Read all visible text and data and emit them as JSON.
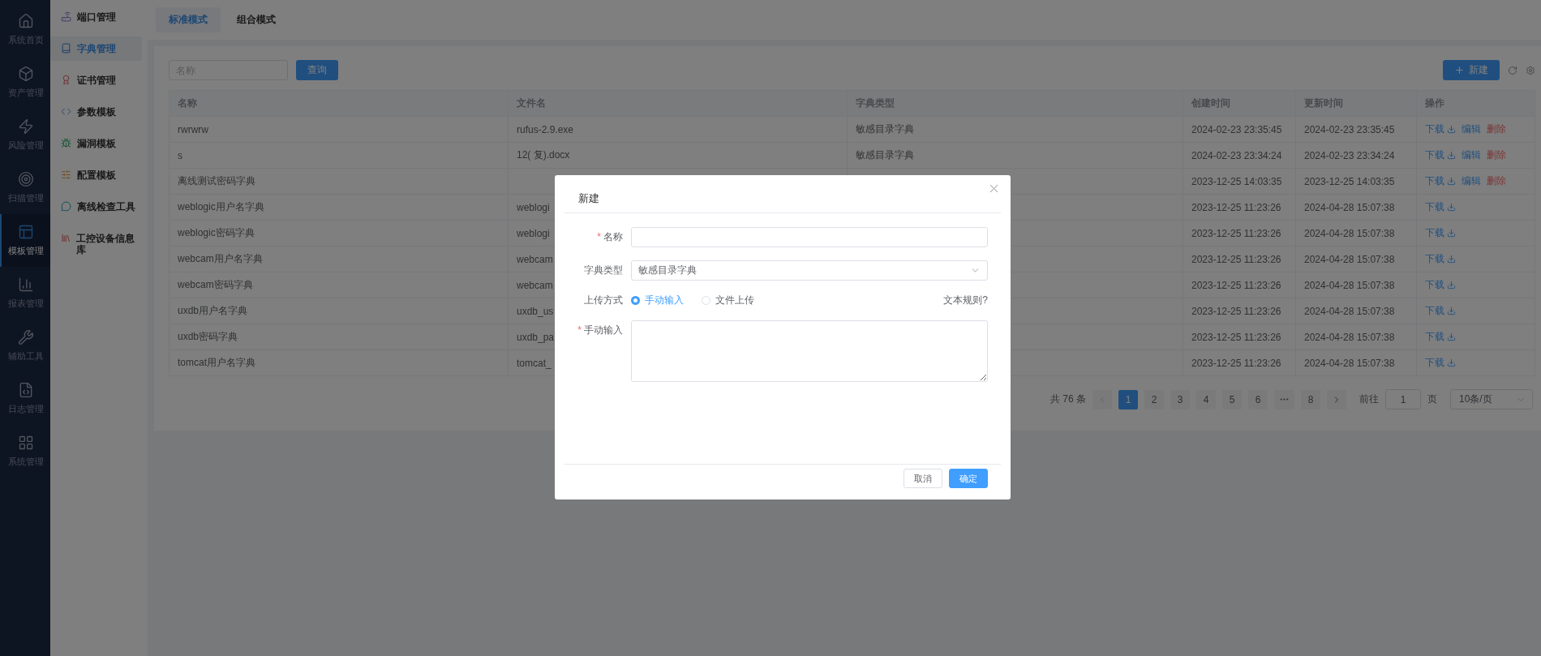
{
  "nav_rail": {
    "items": [
      {
        "label": "系统首页",
        "selected": false
      },
      {
        "label": "资产管理",
        "selected": false
      },
      {
        "label": "风险管理",
        "selected": false
      },
      {
        "label": "扫描管理",
        "selected": false
      },
      {
        "label": "模板管理",
        "selected": true
      },
      {
        "label": "报表管理",
        "selected": false
      },
      {
        "label": "辅助工具",
        "selected": false
      },
      {
        "label": "日志管理",
        "selected": false
      },
      {
        "label": "系统管理",
        "selected": false
      }
    ]
  },
  "sidebar": {
    "items": [
      {
        "label": "端口管理",
        "selected": false
      },
      {
        "label": "字典管理",
        "selected": true
      },
      {
        "label": "证书管理",
        "selected": false
      },
      {
        "label": "参数模板",
        "selected": false
      },
      {
        "label": "漏洞模板",
        "selected": false
      },
      {
        "label": "配置模板",
        "selected": false
      },
      {
        "label": "离线检查工具",
        "selected": false
      },
      {
        "label": "工控设备信息库",
        "selected": false
      }
    ]
  },
  "mode_tabs": [
    {
      "label": "标准模式",
      "selected": true
    },
    {
      "label": "组合模式",
      "selected": false
    }
  ],
  "toolbar": {
    "search": {
      "placeholder": "名称"
    },
    "query_button": "查询",
    "new_button": "新建"
  },
  "table": {
    "columns": [
      "名称",
      "文件名",
      "字典类型",
      "创建时间",
      "更新时间",
      "操作"
    ],
    "rows": [
      {
        "name": "rwrwrw",
        "file_name": "rufus-2.9.exe",
        "dict_type": "敏感目录字典",
        "created": "2024-02-23 23:35:45",
        "updated": "2024-02-23 23:35:45",
        "actions": [
          {
            "kind": "download",
            "label": "下载"
          },
          {
            "kind": "edit",
            "label": "编辑"
          },
          {
            "kind": "delete",
            "label": "删除"
          }
        ]
      },
      {
        "name": "s",
        "file_name": "12( 复).docx",
        "dict_type": "敏感目录字典",
        "created": "2024-02-23 23:34:24",
        "updated": "2024-02-23 23:34:24",
        "actions": [
          {
            "kind": "download",
            "label": "下载"
          },
          {
            "kind": "edit",
            "label": "编辑"
          },
          {
            "kind": "delete",
            "label": "删除"
          }
        ]
      },
      {
        "name": "离线测试密码字典",
        "created": "2023-12-25 14:03:35",
        "updated": "2023-12-25 14:03:35",
        "actions": [
          {
            "kind": "download",
            "label": "下载"
          },
          {
            "kind": "edit",
            "label": "编辑"
          },
          {
            "kind": "delete",
            "label": "删除"
          }
        ]
      },
      {
        "name": "weblogic用户名字典",
        "file_name": "weblogi",
        "created": "2023-12-25 11:23:26",
        "updated": "2024-04-28 15:07:38",
        "actions": [
          {
            "kind": "download",
            "label": "下载"
          }
        ]
      },
      {
        "name": "weblogic密码字典",
        "file_name": "weblogi",
        "created": "2023-12-25 11:23:26",
        "updated": "2024-04-28 15:07:38",
        "actions": [
          {
            "kind": "download",
            "label": "下载"
          }
        ]
      },
      {
        "name": "webcam用户名字典",
        "file_name": "webcam",
        "created": "2023-12-25 11:23:26",
        "updated": "2024-04-28 15:07:38",
        "actions": [
          {
            "kind": "download",
            "label": "下载"
          }
        ]
      },
      {
        "name": "webcam密码字典",
        "file_name": "webcam",
        "created": "2023-12-25 11:23:26",
        "updated": "2024-04-28 15:07:38",
        "actions": [
          {
            "kind": "download",
            "label": "下载"
          }
        ]
      },
      {
        "name": "uxdb用户名字典",
        "file_name": "uxdb_us",
        "created": "2023-12-25 11:23:26",
        "updated": "2024-04-28 15:07:38",
        "actions": [
          {
            "kind": "download",
            "label": "下载"
          }
        ]
      },
      {
        "name": "uxdb密码字典",
        "file_name": "uxdb_pa",
        "created": "2023-12-25 11:23:26",
        "updated": "2024-04-28 15:07:38",
        "actions": [
          {
            "kind": "download",
            "label": "下载"
          }
        ]
      },
      {
        "name": "tomcat用户名字典",
        "file_name": "tomcat_",
        "created": "2023-12-25 11:23:26",
        "updated": "2024-04-28 15:07:38",
        "actions": [
          {
            "kind": "download",
            "label": "下载"
          }
        ]
      }
    ]
  },
  "pagination": {
    "total": "共 76 条",
    "pages": [
      {
        "kind": "page",
        "label": "1",
        "selected": true
      },
      {
        "kind": "page",
        "label": "2",
        "selected": false
      },
      {
        "kind": "page",
        "label": "3",
        "selected": false
      },
      {
        "kind": "page",
        "label": "4",
        "selected": false
      },
      {
        "kind": "page",
        "label": "5",
        "selected": false
      },
      {
        "kind": "page",
        "label": "6",
        "selected": false
      },
      {
        "kind": "more",
        "selected": false
      },
      {
        "kind": "page",
        "label": "8",
        "selected": false
      }
    ],
    "goto_label": "前往",
    "goto_value": "1",
    "page_unit": "页",
    "page_size": "10条/页"
  },
  "dialog": {
    "title": "新建",
    "fields": [
      {
        "kind": "input",
        "label": "名称",
        "required_mark": "*"
      },
      {
        "kind": "select",
        "label": "字典类型",
        "value": "敏感目录字典"
      },
      {
        "kind": "radio",
        "label": "上传方式",
        "options": [
          {
            "label": "手动输入",
            "selected": true
          },
          {
            "label": "文件上传",
            "selected": false
          }
        ],
        "help_link": "文本规则?"
      },
      {
        "kind": "textarea",
        "label": "手动输入",
        "required_mark": "*"
      }
    ],
    "buttons": [
      {
        "kind": "secondary",
        "label": "取消"
      },
      {
        "kind": "primary",
        "label": "确定"
      }
    ]
  }
}
